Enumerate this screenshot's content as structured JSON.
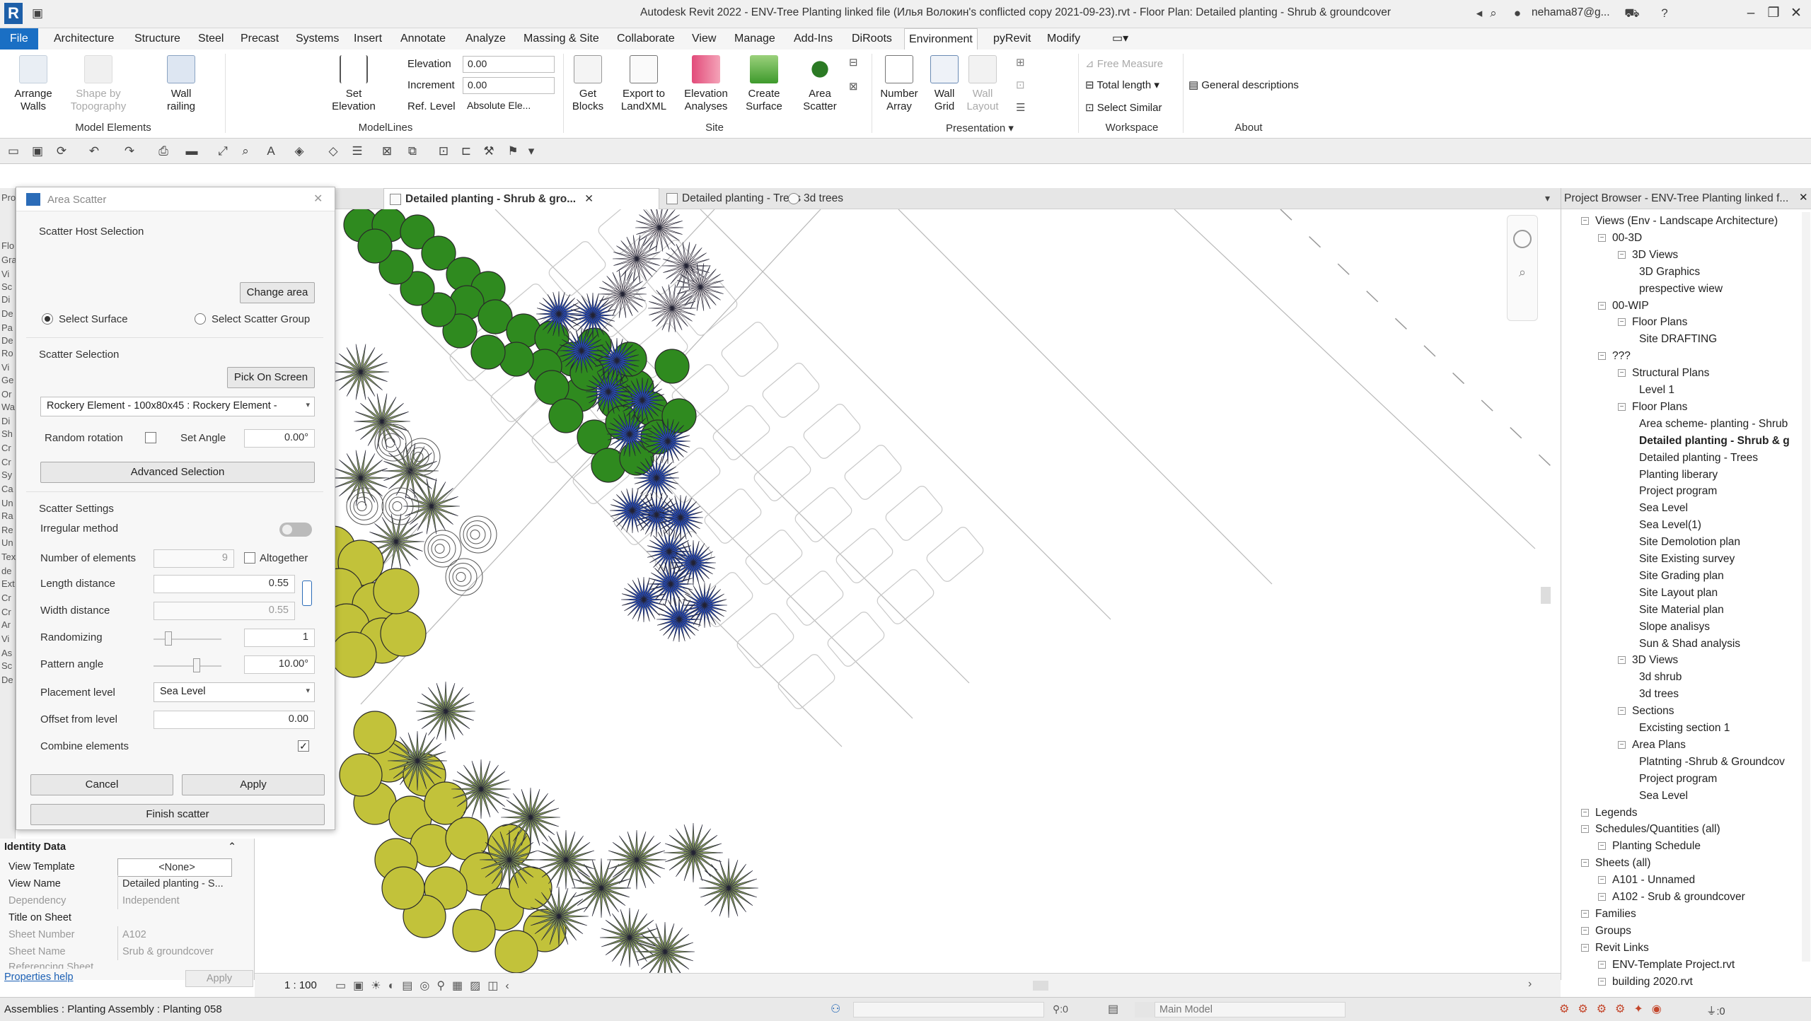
{
  "titlebar": {
    "title": "Autodesk Revit 2022 - ENV-Tree Planting linked file (Илья Волокин's conflicted copy 2021-09-23).rvt - Floor Plan: Detailed planting - Shrub & groundcover",
    "user": "nehama87@g...",
    "logo_letter": "R"
  },
  "menu": {
    "tabs": [
      "File",
      "Architecture",
      "Structure",
      "Steel",
      "Precast",
      "Systems",
      "Insert",
      "Annotate",
      "Analyze",
      "Massing & Site",
      "Collaborate",
      "View",
      "Manage",
      "Add-Ins",
      "DiRoots",
      "Environment",
      "pyRevit",
      "Modify"
    ],
    "active": "Environment"
  },
  "ribbon": {
    "arrange_walls": "Arrange\nWalls",
    "shape_by_topo": "Shape by\nTopography",
    "wall_railing": "Wall\nrailing",
    "set_elevation": "Set\nElevation",
    "elevation_label": "Elevation",
    "elevation_value": "0.00",
    "increment_label": "Increment",
    "increment_value": "0.00",
    "ref_level_label": "Ref. Level",
    "ref_level_value": "Absolute Ele...",
    "get_blocks": "Get\nBlocks",
    "export_landxml": "Export to\nLandXML",
    "elevation_analyses": "Elevation\nAnalyses",
    "create_surface": "Create\nSurface",
    "area_scatter": "Area\nScatter",
    "number_array": "Number\nArray",
    "wall_grid": "Wall\nGrid",
    "wall_layout": "Wall\nLayout",
    "free_measure": "Free Measure",
    "total_length": "Total length",
    "select_similar": "Select Similar",
    "general_descriptions": "General  descriptions",
    "panels": {
      "model_elements": "Model Elements",
      "modellines": "ModelLines",
      "site": "Site",
      "presentation": "Presentation",
      "workspace": "Workspace",
      "about": "About"
    }
  },
  "viewtabs": [
    {
      "label": "Detailed planting - Shrub & gro...",
      "active": true
    },
    {
      "label": "Detailed planting - Trees",
      "active": false
    },
    {
      "label": "3d trees",
      "active": false
    }
  ],
  "dialog": {
    "title": "Area Scatter",
    "host_section": "Scatter Host Selection",
    "change_area": "Change area",
    "select_surface": "Select Surface",
    "select_scatter_group": "Select Scatter Group",
    "scatter_selection": "Scatter Selection",
    "pick_on_screen": "Pick On Screen",
    "element_type": "Rockery Element - 100x80x45 : Rockery Element -",
    "random_rotation": "Random rotation",
    "set_angle": "Set Angle",
    "set_angle_value": "0.00°",
    "advanced_selection": "Advanced Selection",
    "scatter_settings": "Scatter Settings",
    "irregular_method": "Irregular method",
    "number_of_elements": "Number of elements",
    "number_of_elements_value": "9",
    "altogether": "Altogether",
    "length_distance": "Length distance",
    "length_distance_value": "0.55",
    "width_distance": "Width distance",
    "width_distance_value": "0.55",
    "randomizing": "Randomizing",
    "randomizing_value": "1",
    "pattern_angle": "Pattern angle",
    "pattern_angle_value": "10.00°",
    "placement_level": "Placement level",
    "placement_level_value": "Sea Level",
    "offset_from_level": "Offset from level",
    "offset_value": "0.00",
    "combine_elements": "Combine elements",
    "cancel": "Cancel",
    "apply": "Apply",
    "finish_scatter": "Finish scatter"
  },
  "properties": {
    "section": "Identity Data",
    "rows": [
      {
        "k": "View Template",
        "v": "<None>"
      },
      {
        "k": "View Name",
        "v": "Detailed planting - S..."
      },
      {
        "k": "Dependency",
        "v": "Independent"
      },
      {
        "k": "Title on Sheet",
        "v": ""
      },
      {
        "k": "Sheet Number",
        "v": "A102"
      },
      {
        "k": "Sheet Name",
        "v": "Srub & groundcover"
      },
      {
        "k": "Referencing Sheet",
        "v": ""
      }
    ],
    "help": "Properties help",
    "apply": "Apply"
  },
  "browser": {
    "title": "Project Browser - ENV-Tree Planting linked f...",
    "items": [
      {
        "t": "Views (Env - Landscape Architecture)",
        "lvl": 0
      },
      {
        "t": "00-3D",
        "lvl": 1
      },
      {
        "t": "3D Views",
        "lvl": 2
      },
      {
        "t": "3D Graphics",
        "lvl": 3
      },
      {
        "t": "prespective wiew",
        "lvl": 3
      },
      {
        "t": "00-WIP",
        "lvl": 1
      },
      {
        "t": "Floor Plans",
        "lvl": 2
      },
      {
        "t": "Site DRAFTING",
        "lvl": 3
      },
      {
        "t": "???",
        "lvl": 1
      },
      {
        "t": "Structural Plans",
        "lvl": 2
      },
      {
        "t": "Level 1",
        "lvl": 3
      },
      {
        "t": "Floor Plans",
        "lvl": 2
      },
      {
        "t": "Area scheme- planting - Shrub",
        "lvl": 3
      },
      {
        "t": "Detailed planting - Shrub & g",
        "lvl": 3,
        "bold": true
      },
      {
        "t": "Detailed planting - Trees",
        "lvl": 3
      },
      {
        "t": "Planting liberary",
        "lvl": 3
      },
      {
        "t": "Project program",
        "lvl": 3
      },
      {
        "t": "Sea Level",
        "lvl": 3
      },
      {
        "t": "Sea Level(1)",
        "lvl": 3
      },
      {
        "t": "Site Demolotion plan",
        "lvl": 3
      },
      {
        "t": "Site Existing survey",
        "lvl": 3
      },
      {
        "t": "Site Grading plan",
        "lvl": 3
      },
      {
        "t": "Site Layout plan",
        "lvl": 3
      },
      {
        "t": "Site Material plan",
        "lvl": 3
      },
      {
        "t": "Slope analisys",
        "lvl": 3
      },
      {
        "t": "Sun & Shad analysis",
        "lvl": 3
      },
      {
        "t": "3D Views",
        "lvl": 2
      },
      {
        "t": "3d shrub",
        "lvl": 3
      },
      {
        "t": "3d trees",
        "lvl": 3
      },
      {
        "t": "Sections",
        "lvl": 2
      },
      {
        "t": "Excisting section 1",
        "lvl": 3
      },
      {
        "t": "Area Plans",
        "lvl": 2
      },
      {
        "t": "Platnting -Shrub & Groundcov",
        "lvl": 3
      },
      {
        "t": "Project program",
        "lvl": 3
      },
      {
        "t": "Sea Level",
        "lvl": 3
      },
      {
        "t": "Legends",
        "lvl": 0
      },
      {
        "t": "Schedules/Quantities (all)",
        "lvl": 0
      },
      {
        "t": "Planting Schedule",
        "lvl": 1
      },
      {
        "t": "Sheets (all)",
        "lvl": 0
      },
      {
        "t": "A101 - Unnamed",
        "lvl": 1
      },
      {
        "t": "A102 - Srub & groundcover",
        "lvl": 1
      },
      {
        "t": "Families",
        "lvl": 0
      },
      {
        "t": "Groups",
        "lvl": 0
      },
      {
        "t": "Revit Links",
        "lvl": 0
      },
      {
        "t": "ENV-Template Project.rvt",
        "lvl": 1
      },
      {
        "t": "building 2020.rvt",
        "lvl": 1
      }
    ]
  },
  "viewcontrol": {
    "scale": "1 : 100"
  },
  "status": {
    "text": "Assemblies : Planting Assembly : Planting 058",
    "model": "Main Model",
    "count": ":0",
    "filter": ":0"
  },
  "colors": {
    "accent": "#1a6fc4",
    "green_tree": "#2f8a1f",
    "yellow_shrub": "#c2c23a",
    "blue_flower": "#2a52c8"
  },
  "left_strip_labels": [
    "Pro",
    "Flo",
    "Gra",
    "Vi",
    "Sc",
    "Di",
    "De",
    "Pa",
    "De",
    "Ro",
    "Vi",
    "Ge",
    "Or",
    "Wa",
    "Di",
    "Sh",
    "Cr",
    "Cr",
    "Sy",
    "Ca",
    "Un",
    "Ra",
    "Re",
    "Un",
    "Tex",
    "de",
    "Ext",
    "Cr",
    "Cr",
    "Ar",
    "Vi",
    "As",
    "Sc",
    "De"
  ]
}
